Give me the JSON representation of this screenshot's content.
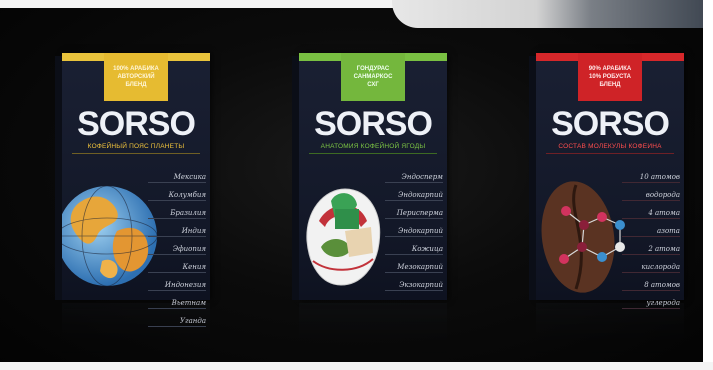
{
  "boxes": [
    {
      "tag": [
        "100% АРАБИКА",
        "АВТОРСКИЙ",
        "БЛЕНД"
      ],
      "brand": "SORSO",
      "subtitle": "КОФЕЙНЫЙ ПОЯС ПЛАНЕТЫ",
      "accent": "#e9c33c",
      "illustration": "globe",
      "script": [
        "Мексика",
        "Колумбия",
        "Бразилия",
        "Индия",
        "Эфиопия",
        "Кения",
        "Индонезия",
        "Вьетнам",
        "Уганда"
      ]
    },
    {
      "tag": [
        "ГОНДУРАС",
        "САНМАРКОС",
        "СХГ"
      ],
      "brand": "SORSO",
      "subtitle": "АНАТОМИЯ КОФЕЙНОЙ ЯГОДЫ",
      "accent": "#79c042",
      "illustration": "coffee-cherry",
      "script": [
        "Эндосперм",
        "Эндокарпий",
        "Перисперма",
        "Эндокарпий",
        "Кожица",
        "Мезокарпий",
        "Экзокарпий"
      ]
    },
    {
      "tag": [
        "90% АРАБИКА",
        "10% РОБУСТА",
        "БЛЕНД"
      ],
      "brand": "SORSO",
      "subtitle": "СОСТАВ МОЛЕКУЛЫ КОФЕИНА",
      "accent": "#d6272a",
      "illustration": "caffeine-molecule",
      "script": [
        "10 атомов",
        "водорода",
        "4 атома",
        "азота",
        "2 атома",
        "кислорода",
        "8 атомов",
        "углерода"
      ]
    }
  ]
}
